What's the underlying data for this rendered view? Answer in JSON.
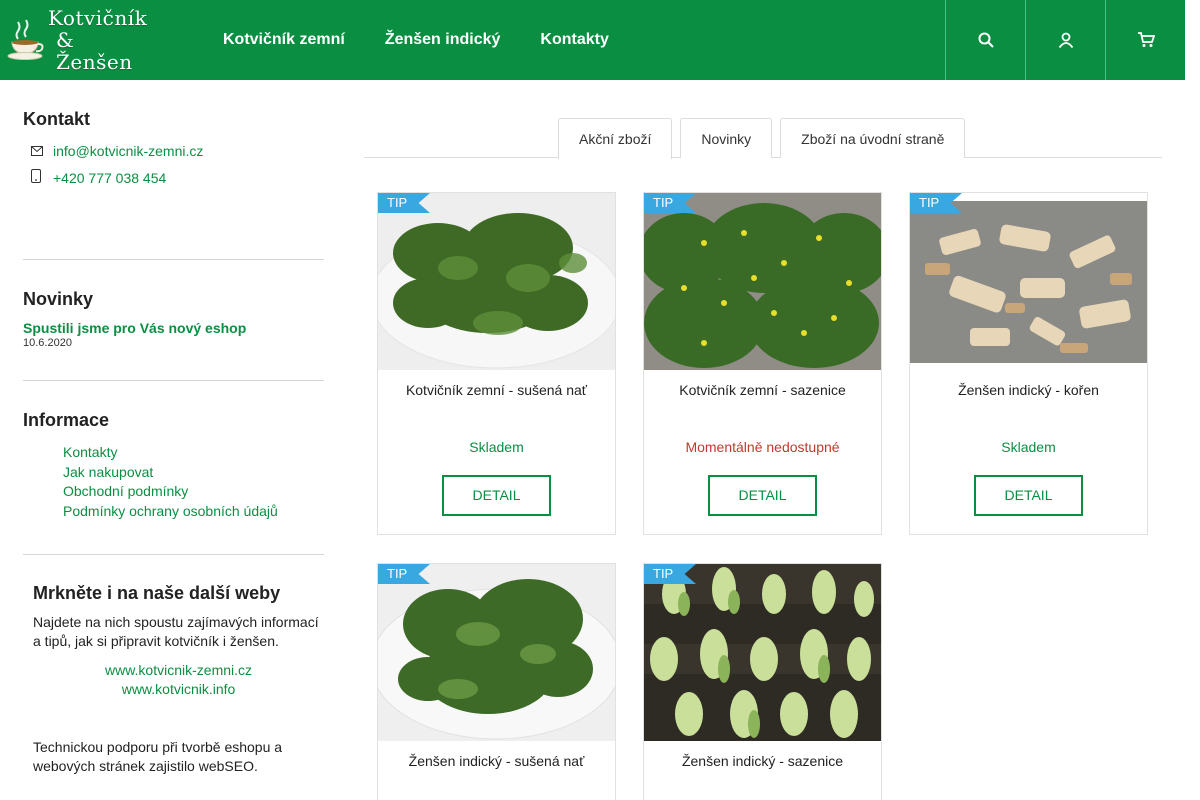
{
  "header": {
    "logo": {
      "line1": "Kotvičník",
      "line2": "& Ženšen"
    },
    "nav": [
      "Kotvičník zemní",
      "Ženšen indický",
      "Kontakty"
    ],
    "icons": [
      "search-icon",
      "user-icon",
      "cart-icon"
    ]
  },
  "sidebar": {
    "contact": {
      "heading": "Kontakt",
      "email": "info@kotvicnik-zemni.cz",
      "phone": "+420 777 038 454"
    },
    "news": {
      "heading": "Novinky",
      "item_title": "Spustili jsme pro Vás nový eshop",
      "item_date": "10.6.2020"
    },
    "info": {
      "heading": "Informace",
      "links": [
        "Kontakty",
        "Jak nakupovat",
        "Obchodní podmínky",
        "Podmínky ochrany osobních údajů"
      ]
    },
    "more": {
      "heading": "Mrkněte i na naše další weby",
      "text": "Najdete na nich spoustu zajímavých informací a tipů, jak si připravit kotvičník i ženšen.",
      "links": [
        "www.kotvicnik-zemni.cz",
        "www.kotvicnik.info"
      ],
      "support": "Technickou podporu při tvorbě eshopu a webových stránek zajistilo webSEO."
    }
  },
  "tabs": [
    "Akční zboží",
    "Novinky",
    "Zboží na úvodní straně"
  ],
  "products": [
    {
      "badge": "TIP",
      "name": "Kotvičník zemní - sušená nať",
      "stock": "Skladem",
      "button": "DETAIL"
    },
    {
      "badge": "TIP",
      "name": "Kotvičník zemní - sazenice",
      "stock": "Momentálně nedostupné",
      "button": "DETAIL"
    },
    {
      "badge": "TIP",
      "name": "Ženšen indický - kořen",
      "stock": "Skladem",
      "button": "DETAIL"
    },
    {
      "badge": "TIP",
      "name": "Ženšen indický - sušená nať",
      "stock": "",
      "button": ""
    },
    {
      "badge": "TIP",
      "name": "Ženšen indický - sazenice",
      "stock": "",
      "button": ""
    }
  ],
  "colors": {
    "brand": "#0a8f42",
    "badge": "#3aa8e0",
    "unavailable": "#c0392b"
  }
}
